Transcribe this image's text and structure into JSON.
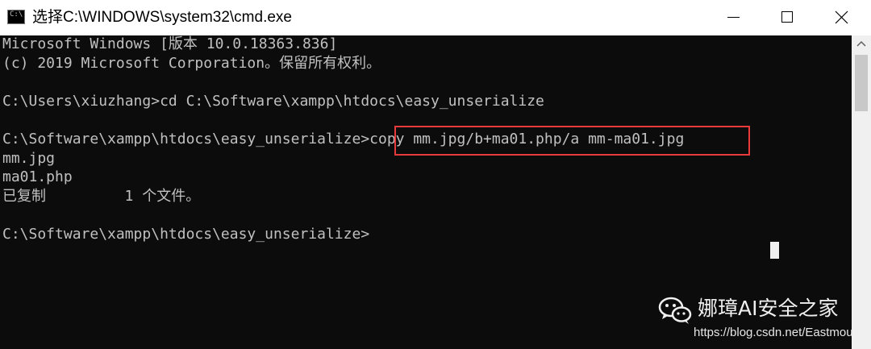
{
  "window": {
    "title": "选择C:\\WINDOWS\\system32\\cmd.exe",
    "icon_text": "C:\\"
  },
  "console": {
    "lines": [
      "Microsoft Windows [版本 10.0.18363.836]",
      "(c) 2019 Microsoft Corporation。保留所有权利。",
      "",
      "C:\\Users\\xiuzhang>cd C:\\Software\\xampp\\htdocs\\easy_unserialize",
      "",
      "C:\\Software\\xampp\\htdocs\\easy_unserialize>copy mm.jpg/b+ma01.php/a mm-ma01.jpg",
      "mm.jpg",
      "ma01.php",
      "已复制         1 个文件。",
      "",
      "C:\\Software\\xampp\\htdocs\\easy_unserialize>"
    ]
  },
  "watermark": {
    "brand": "娜璋AI安全之家",
    "url": "https://blog.csdn.net/Eastmou"
  },
  "colors": {
    "console_text": "#c0c0c0",
    "highlight_border": "#e83a3a"
  }
}
